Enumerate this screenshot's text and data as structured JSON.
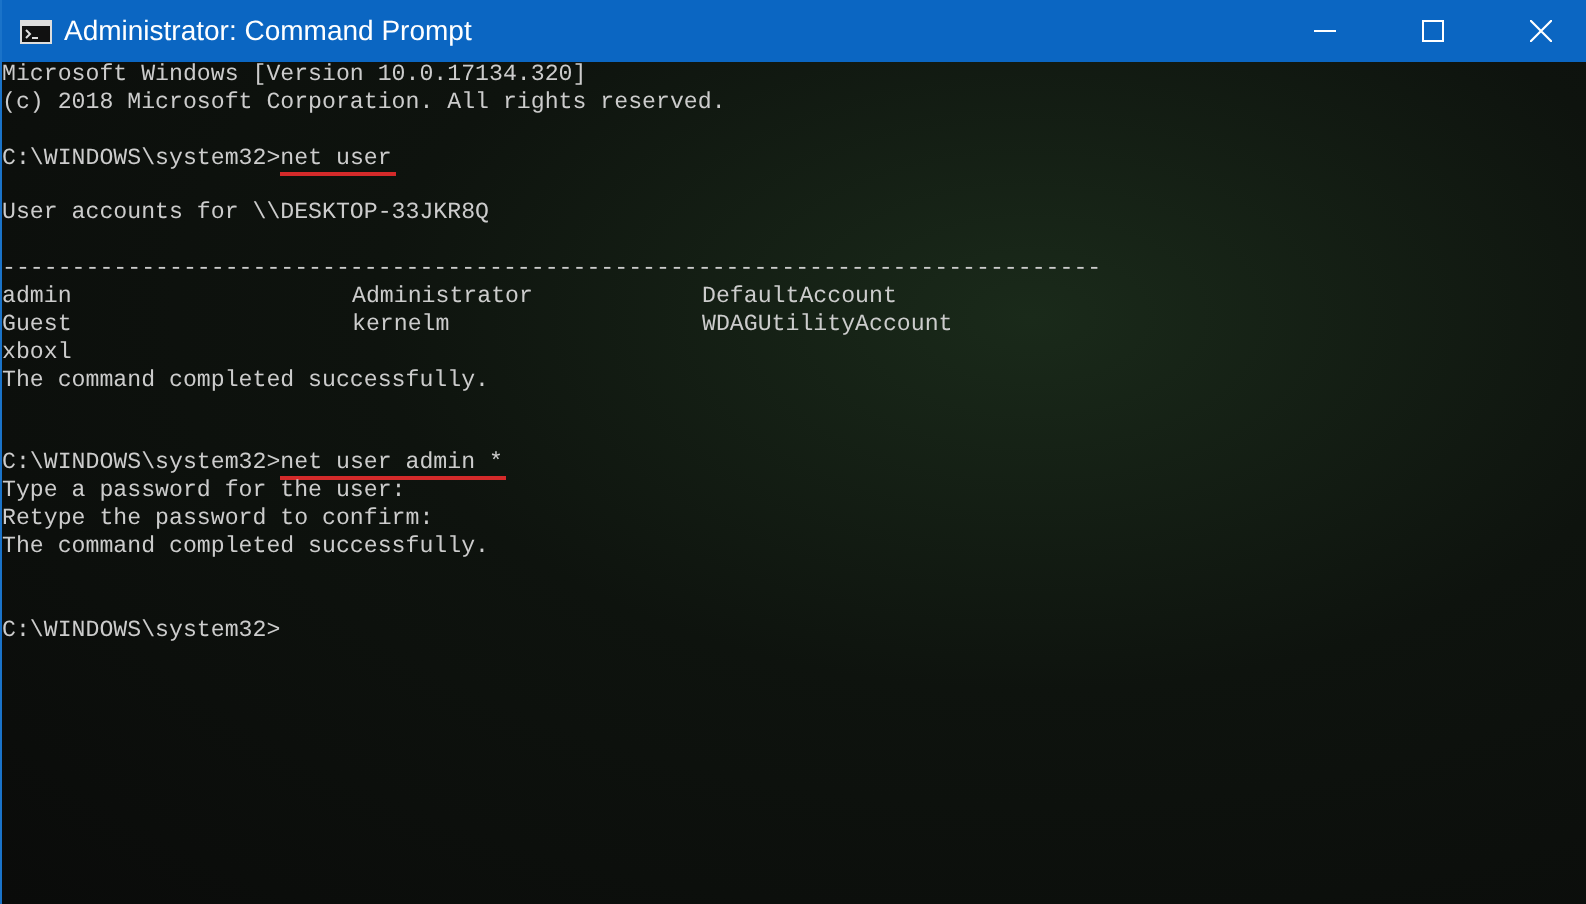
{
  "window": {
    "title": "Administrator: Command Prompt"
  },
  "console_lines": [
    {
      "kind": "output",
      "text": "Microsoft Windows [Version 10.0.17134.320]"
    },
    {
      "kind": "output",
      "text": "(c) 2018 Microsoft Corporation. All rights reserved."
    },
    {
      "kind": "blank"
    },
    {
      "kind": "prompt",
      "path": "C:\\WINDOWS\\system32>",
      "command": "net user",
      "underlined": true
    },
    {
      "kind": "blank"
    },
    {
      "kind": "output",
      "text": "User accounts for \\\\DESKTOP-33JKR8Q"
    },
    {
      "kind": "blank"
    },
    {
      "kind": "output",
      "text": "-------------------------------------------------------------------------------"
    },
    {
      "kind": "row",
      "cells": [
        "admin",
        "Administrator",
        "DefaultAccount"
      ]
    },
    {
      "kind": "row",
      "cells": [
        "Guest",
        "kernelm",
        "WDAGUtilityAccount"
      ]
    },
    {
      "kind": "row",
      "cells": [
        "xboxl"
      ]
    },
    {
      "kind": "output",
      "text": "The command completed successfully."
    },
    {
      "kind": "blank"
    },
    {
      "kind": "blank"
    },
    {
      "kind": "prompt",
      "path": "C:\\WINDOWS\\system32>",
      "command": "net user admin *",
      "underlined": true
    },
    {
      "kind": "output",
      "text": "Type a password for the user:"
    },
    {
      "kind": "output",
      "text": "Retype the password to confirm:"
    },
    {
      "kind": "output",
      "text": "The command completed successfully."
    },
    {
      "kind": "blank"
    },
    {
      "kind": "blank"
    },
    {
      "kind": "prompt",
      "path": "C:\\WINDOWS\\system32>"
    }
  ]
}
